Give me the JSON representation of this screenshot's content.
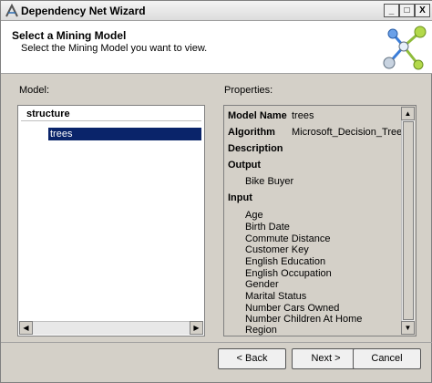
{
  "window": {
    "title": "Dependency Net Wizard",
    "controls": {
      "minimize": "_",
      "maximize": "□",
      "close": "X"
    }
  },
  "header": {
    "title": "Select a Mining Model",
    "subtitle": "Select the Mining Model you want to view."
  },
  "model_panel": {
    "label": "Model:",
    "header": "structure",
    "items": [
      "trees"
    ],
    "selected_item": "trees"
  },
  "properties_panel": {
    "label": "Properties:",
    "model_name_label": "Model Name",
    "model_name_value": "trees",
    "algorithm_label": "Algorithm",
    "algorithm_value": "Microsoft_Decision_Trees",
    "description_label": "Description",
    "output_label": "Output",
    "outputs": [
      "Bike Buyer"
    ],
    "input_label": "Input",
    "inputs": [
      "Age",
      "Birth Date",
      "Commute Distance",
      "Customer Key",
      "English Education",
      "English Occupation",
      "Gender",
      "Marital Status",
      "Number Cars Owned",
      "Number Children At Home",
      "Region"
    ]
  },
  "buttons": {
    "back": "< Back",
    "next": "Next >",
    "cancel": "Cancel"
  },
  "icons": {
    "title_icon": "wizard-icon",
    "header_graphic": "dependency-network-icon"
  },
  "colors": {
    "selection": "#0a246a",
    "dialog_bg": "#d4d0c8"
  }
}
